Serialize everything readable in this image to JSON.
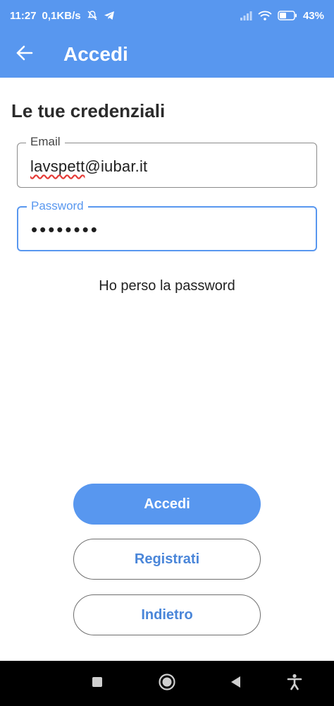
{
  "status_bar": {
    "time": "11:27",
    "network_speed": "0,1KB/s",
    "battery_percent": "43%",
    "icons": [
      "bell-off-icon",
      "telegram-icon",
      "signal-icon",
      "wifi-icon",
      "battery-icon"
    ]
  },
  "app_bar": {
    "title": "Accedi",
    "back_icon": "arrow-left-icon"
  },
  "form": {
    "section_title": "Le tue credenziali",
    "email": {
      "label": "Email",
      "value_misspelled": "lavspett",
      "value_rest": "@iubar.it"
    },
    "password": {
      "label": "Password",
      "value": "••••••••"
    },
    "forgot_link": "Ho perso la password"
  },
  "buttons": {
    "login": "Accedi",
    "register": "Registrati",
    "back": "Indietro"
  },
  "nav_bar": {
    "icons": [
      "square-icon",
      "home-circle-icon",
      "back-triangle-icon",
      "accessibility-icon"
    ]
  },
  "colors": {
    "accent": "#5897ef",
    "accent_text": "#4a86d9",
    "spell_error": "#e53935"
  }
}
